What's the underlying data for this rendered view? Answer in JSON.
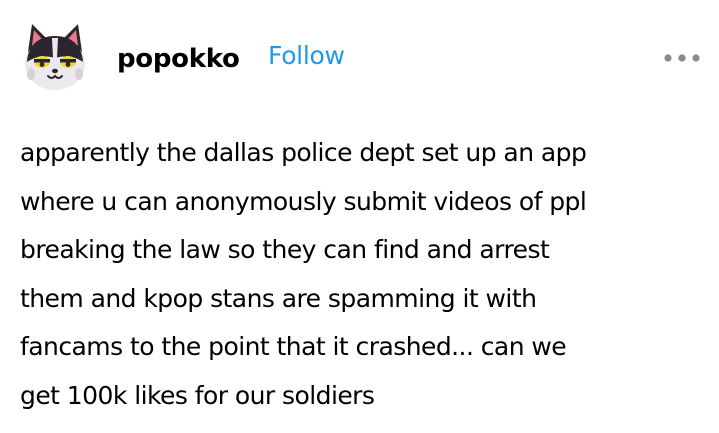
{
  "post": {
    "author": {
      "username": "popokko",
      "avatar_icon": "cat-avatar-icon"
    },
    "follow_label": "Follow",
    "menu_icon": "more-dots-icon",
    "accent_color": "#1f9ae6",
    "body_lines": [
      "apparently the dallas police dept set up an app",
      "where u can anonymously submit videos of ppl",
      "breaking the law so they can find and arrest",
      "them and kpop stans are spamming it with",
      "fancams to the point that it crashed... can we",
      "get 100k likes for our soldiers"
    ]
  }
}
